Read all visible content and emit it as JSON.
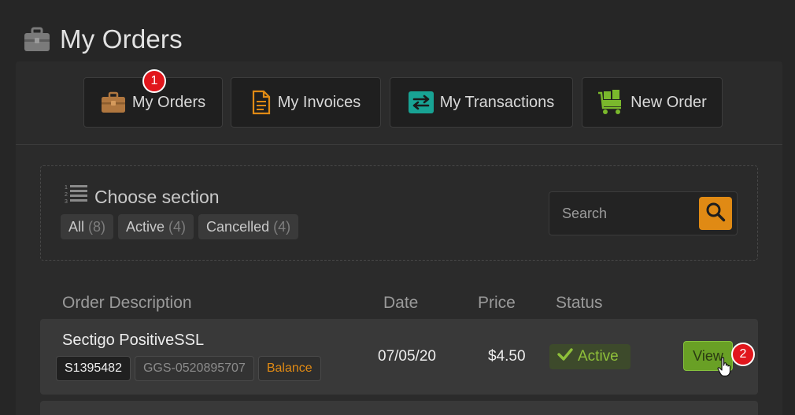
{
  "page": {
    "title": "My Orders",
    "title_icon": "briefcase-icon"
  },
  "tabs": [
    {
      "label": "My Orders",
      "icon": "briefcase-icon",
      "badge": "1"
    },
    {
      "label": "My Invoices",
      "icon": "document-icon"
    },
    {
      "label": "My Transactions",
      "icon": "transfer-arrows-icon"
    },
    {
      "label": "New Order",
      "icon": "cart-icon"
    }
  ],
  "filter": {
    "heading": "Choose section",
    "heading_icon": "numbered-list-icon",
    "options": [
      {
        "label": "All",
        "count": "(8)"
      },
      {
        "label": "Active",
        "count": "(4)"
      },
      {
        "label": "Cancelled",
        "count": "(4)"
      }
    ]
  },
  "search": {
    "placeholder": "Search",
    "value": "",
    "button_icon": "search-icon"
  },
  "table": {
    "columns": [
      "Order Description",
      "Date",
      "Price",
      "Status"
    ],
    "rows": [
      {
        "product": "Sectigo PositiveSSL",
        "id": "S1395482",
        "ref": "GGS-0520895707",
        "payment": "Balance",
        "date": "07/05/20",
        "price": "$4.50",
        "status": "Active",
        "status_icon": "check-icon",
        "action": "View",
        "action_badge": "2"
      }
    ]
  },
  "colors": {
    "accent_orange": "#e08a14",
    "active_green": "#8fc03a",
    "view_button_green": "#69a025",
    "badge_red": "#e1161c"
  }
}
